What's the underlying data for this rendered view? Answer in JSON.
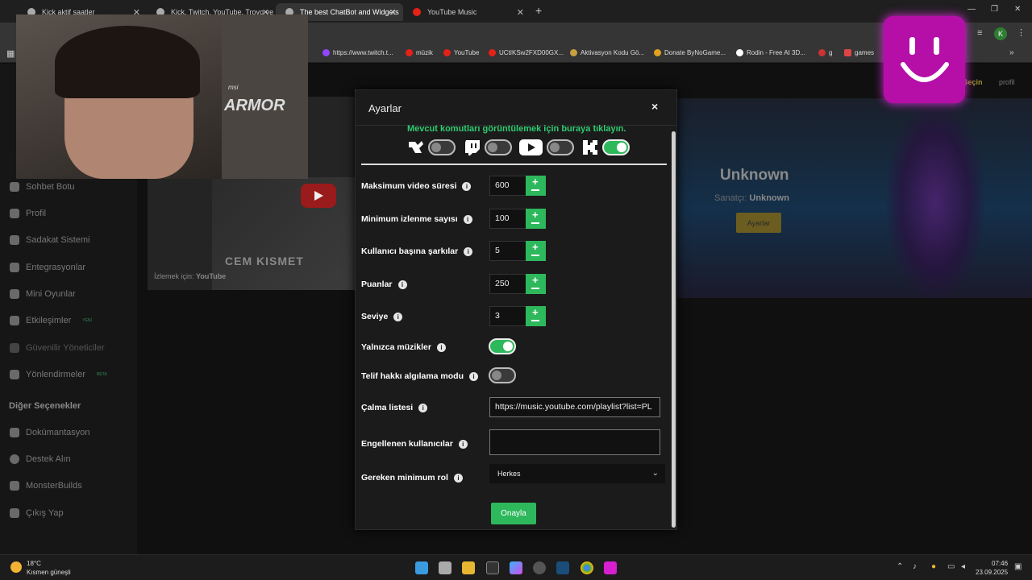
{
  "browser": {
    "tabs": [
      {
        "label": "Kick aktif saatler"
      },
      {
        "label": "Kick, Twitch, YouTube, Trovo ve"
      },
      {
        "label": "The best ChatBot and Widgets"
      },
      {
        "label": "YouTube Music"
      }
    ],
    "new_tab": "+",
    "bookmarks": [
      {
        "label": "https://www.twitch.t..."
      },
      {
        "label": "müzik"
      },
      {
        "label": "YouTube"
      },
      {
        "label": "UCtIKSw2FXD00GX..."
      },
      {
        "label": "Aktivasyon Kodu Gö..."
      },
      {
        "label": "Donate ByNoGame..."
      },
      {
        "label": "Rodin - Free AI 3D..."
      },
      {
        "label": "g"
      },
      {
        "label": "games"
      }
    ],
    "profile_initial": "K"
  },
  "sidebar": {
    "items": [
      {
        "label": "Sohbet Botu"
      },
      {
        "label": "Profil"
      },
      {
        "label": "Sadakat Sistemi"
      },
      {
        "label": "Entegrasyonlar"
      },
      {
        "label": "Mini Oyunlar"
      },
      {
        "label": "Etkileşimler",
        "badge": "YENİ"
      },
      {
        "label": "Güvenilir Yöneticiler"
      },
      {
        "label": "Yönlendirmeler",
        "badge": "BETA"
      }
    ],
    "section_title": "Diğer Seçenekler",
    "other_items": [
      {
        "label": "Dokümantasyon"
      },
      {
        "label": "Destek Alın"
      },
      {
        "label": "MonsterBuilds"
      },
      {
        "label": "Çıkış Yap"
      }
    ]
  },
  "video": {
    "watch_label": "İzlemek için:",
    "platform": "YouTube",
    "overlay_text": "CEM KISMET"
  },
  "player": {
    "title": "Unknown",
    "artist_label": "Sanatçı:",
    "artist": "Unknown",
    "settings_button": "Ayarlar"
  },
  "header_right": {
    "switch_label": "a Geçin",
    "profile_label": "profil"
  },
  "webcam": {
    "brand": "msi",
    "product": "ARMOR"
  },
  "modal": {
    "title": "Ayarlar",
    "close": "×",
    "commands_link": "Mevcut komutları görüntülemek için buraya tıklayın.",
    "platforms": [
      {
        "name": "kick-like-icon",
        "enabled": false
      },
      {
        "name": "twitch-icon",
        "enabled": false
      },
      {
        "name": "youtube-icon",
        "enabled": false
      },
      {
        "name": "kick-icon",
        "enabled": true
      }
    ],
    "fields": {
      "max_video": {
        "label": "Maksimum video süresi",
        "value": "600"
      },
      "min_views": {
        "label": "Minimum izlenme sayısı",
        "value": "100"
      },
      "per_user": {
        "label": "Kullanıcı başına şarkılar",
        "value": "5"
      },
      "points": {
        "label": "Puanlar",
        "value": "250"
      },
      "level": {
        "label": "Seviye",
        "value": "3"
      },
      "music_only": {
        "label": "Yalnızca müzikler",
        "enabled": true
      },
      "copyright": {
        "label": "Telif hakkı algılama modu",
        "enabled": false
      },
      "playlist": {
        "label": "Çalma listesi",
        "value": "https://music.youtube.com/playlist?list=PL"
      },
      "blocked": {
        "label": "Engellenen kullanıcılar",
        "value": ""
      },
      "min_role": {
        "label": "Gereken minimum rol",
        "value": "Herkes"
      }
    },
    "confirm": "Onayla"
  },
  "taskbar": {
    "temperature": "18°C",
    "weather": "Kısmen güneşli",
    "time": "07:46",
    "date": "23.09.2025"
  },
  "colors": {
    "accent_green": "#2eb85c",
    "link_green": "#2ecc71",
    "gold": "#6b5c20"
  }
}
